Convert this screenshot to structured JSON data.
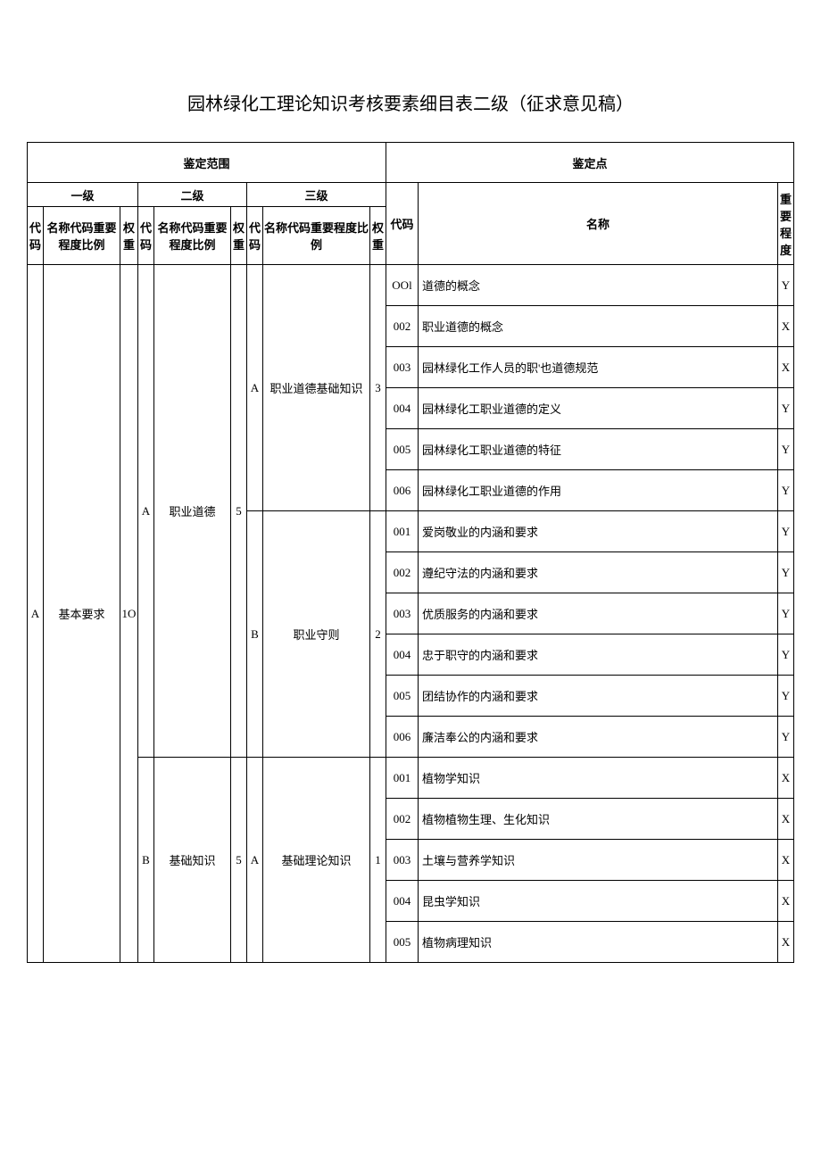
{
  "title": "园林绿化工理论知识考核要素细目表二级（征求意见稿）",
  "hdr": {
    "scope": "鉴定范围",
    "point": "鉴定点",
    "lvl1": "一级",
    "lvl2": "二级",
    "lvl3": "三级",
    "code": "代码",
    "nameRatio": "名称代码重要程度比例",
    "weight": "权重",
    "name": "名称",
    "importance": "重要程度"
  },
  "l1": {
    "code": "A",
    "name": "基本要求",
    "weight": "1O"
  },
  "l2a": {
    "code": "A",
    "name": "职业道德",
    "weight": "5"
  },
  "l2b": {
    "code": "B",
    "name": "基础知识",
    "weight": "5"
  },
  "l3a": {
    "code": "A",
    "name": "职业道德基础知识",
    "weight": "3"
  },
  "l3b": {
    "code": "B",
    "name": "职业守则",
    "weight": "2"
  },
  "l3c": {
    "code": "A",
    "name": "基础理论知识",
    "weight": "1"
  },
  "p": {
    "a1": {
      "c": "OOl",
      "n": "道德的概念",
      "i": "Y"
    },
    "a2": {
      "c": "002",
      "n": "职业道德的概念",
      "i": "X"
    },
    "a3": {
      "c": "003",
      "n": "园林绿化工作人员的职'也道德规范",
      "i": "X"
    },
    "a4": {
      "c": "004",
      "n": "园林绿化工职业道德的定义",
      "i": "Y"
    },
    "a5": {
      "c": "005",
      "n": "园林绿化工职业道德的特征",
      "i": "Y"
    },
    "a6": {
      "c": "006",
      "n": "园林绿化工职业道德的作用",
      "i": "Y"
    },
    "b1": {
      "c": "001",
      "n": "爱岗敬业的内涵和要求",
      "i": "Y"
    },
    "b2": {
      "c": "002",
      "n": "遵纪守法的内涵和要求",
      "i": "Y"
    },
    "b3": {
      "c": "003",
      "n": "优质服务的内涵和要求",
      "i": "Y"
    },
    "b4": {
      "c": "004",
      "n": "忠于职守的内涵和要求",
      "i": "Y"
    },
    "b5": {
      "c": "005",
      "n": "团结协作的内涵和要求",
      "i": "Y"
    },
    "b6": {
      "c": "006",
      "n": "廉洁奉公的内涵和要求",
      "i": "Y"
    },
    "c1": {
      "c": "001",
      "n": "植物学知识",
      "i": "X"
    },
    "c2": {
      "c": "002",
      "n": "植物植物生理、生化知识",
      "i": "X"
    },
    "c3": {
      "c": "003",
      "n": "土壤与营养学知识",
      "i": "X"
    },
    "c4": {
      "c": "004",
      "n": "昆虫学知识",
      "i": "X"
    },
    "c5": {
      "c": "005",
      "n": "植物病理知识",
      "i": "X"
    }
  }
}
